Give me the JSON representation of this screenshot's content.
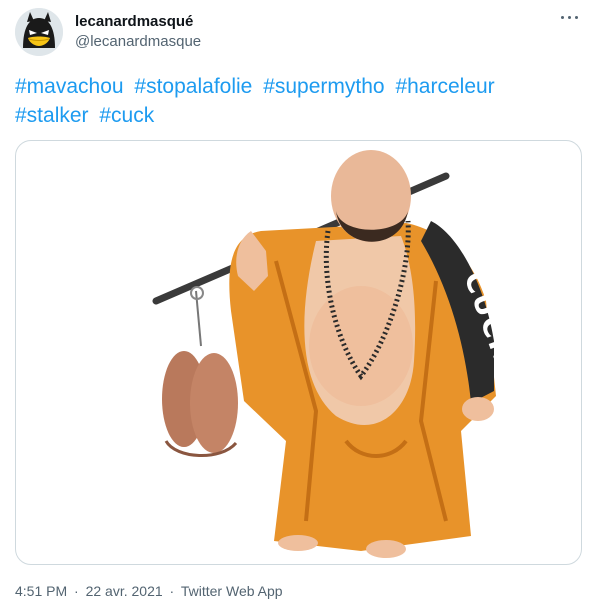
{
  "user": {
    "display_name": "lecanardmasqué",
    "handle": "@lecanardmasque"
  },
  "tweet": {
    "hashtags": [
      "#mavachou",
      "#stopalafolie",
      "#supermytho",
      "#harceleur",
      "#stalker",
      "#cuck"
    ]
  },
  "media": {
    "sash_text": "CUCK"
  },
  "meta": {
    "time": "4:51 PM",
    "separator": "·",
    "date": "22 avr. 2021",
    "source": "Twitter Web App"
  },
  "colors": {
    "link": "#1d9bf0",
    "robe": "#e8932a",
    "secondary_text": "#536471"
  },
  "icons": {
    "more": "more-horizontal-icon",
    "avatar": "batman-duck-avatar"
  }
}
